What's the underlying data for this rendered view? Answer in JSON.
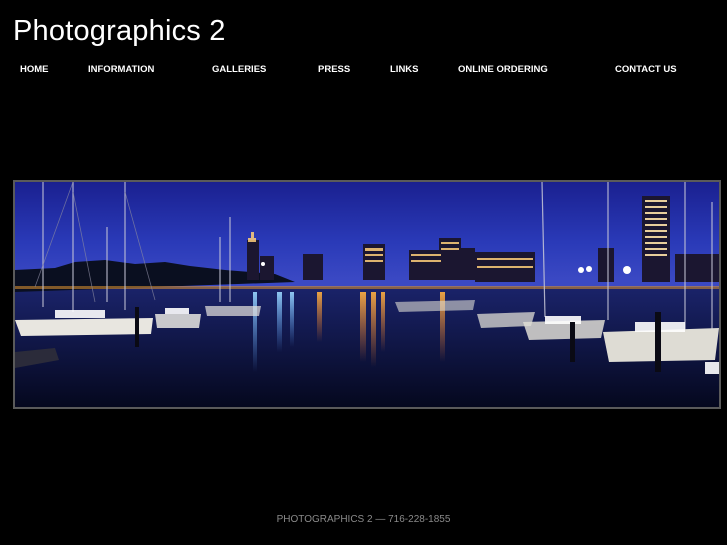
{
  "site": {
    "title": "Photographics 2"
  },
  "nav": {
    "items": [
      {
        "label": "HOME"
      },
      {
        "label": "INFORMATION"
      },
      {
        "label": "GALLERIES"
      },
      {
        "label": "PRESS"
      },
      {
        "label": "LINKS"
      },
      {
        "label": "ONLINE ORDERING"
      },
      {
        "label": "CONTACT US"
      }
    ]
  },
  "hero": {
    "subject": "night-harbor-skyline-panorama"
  },
  "footer": {
    "text": "PHOTOGRAPHICS 2 — 716-228-1855"
  },
  "colors": {
    "background": "#000000",
    "text": "#ffffff",
    "footer_text": "#8a8a8a",
    "photo_border": "#5a5a5a"
  }
}
